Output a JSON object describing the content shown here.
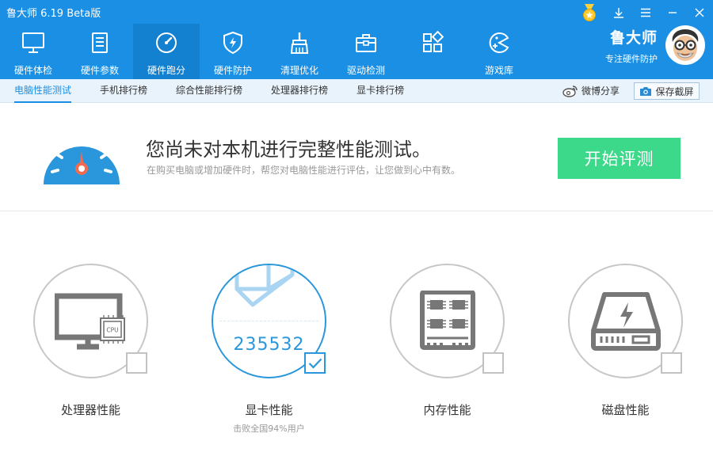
{
  "app": {
    "title": "鲁大师 6.19 Beta版"
  },
  "nav": [
    {
      "label": "硬件体检",
      "icon": "monitor-icon"
    },
    {
      "label": "硬件参数",
      "icon": "clipboard-icon"
    },
    {
      "label": "硬件跑分",
      "icon": "speedometer-icon"
    },
    {
      "label": "硬件防护",
      "icon": "shield-icon"
    },
    {
      "label": "清理优化",
      "icon": "broom-icon"
    },
    {
      "label": "驱动检测",
      "icon": "toolbox-icon"
    },
    {
      "label": "",
      "icon": "apps-icon"
    },
    {
      "label": "游戏库",
      "icon": "game-icon"
    }
  ],
  "nav_active": "硬件跑分",
  "brand": {
    "name": "鲁大师",
    "slogan": "专注硬件防护"
  },
  "subtabs": [
    "电脑性能测试",
    "手机排行榜",
    "综合性能排行榜",
    "处理器排行榜",
    "显卡排行榜"
  ],
  "subtab_active": "电脑性能测试",
  "share": {
    "weibo": "微博分享",
    "screenshot": "保存截屏"
  },
  "banner": {
    "title": "您尚未对本机进行完整性能测试。",
    "subtitle": "在购买电脑或增加硬件时，帮您对电脑性能进行评估，让您做到心中有数。",
    "start_button": "开始评测"
  },
  "cards": [
    {
      "label": "处理器性能",
      "checked": false,
      "score": "",
      "sub": "",
      "icon": "cpu-monitor-icon"
    },
    {
      "label": "显卡性能",
      "checked": true,
      "score": "235532",
      "sub": "击败全国94%用户",
      "icon": "gpu-cube-icon"
    },
    {
      "label": "内存性能",
      "checked": false,
      "score": "",
      "sub": "",
      "icon": "memory-icon"
    },
    {
      "label": "磁盘性能",
      "checked": false,
      "score": "",
      "sub": "",
      "icon": "disk-icon"
    }
  ],
  "cpu_chip_text": "CPU",
  "colors": {
    "primary": "#1a8fe4",
    "start_button": "#3dd98b",
    "ring_active": "#2a97dc",
    "ring_idle": "#c7c7c7"
  }
}
